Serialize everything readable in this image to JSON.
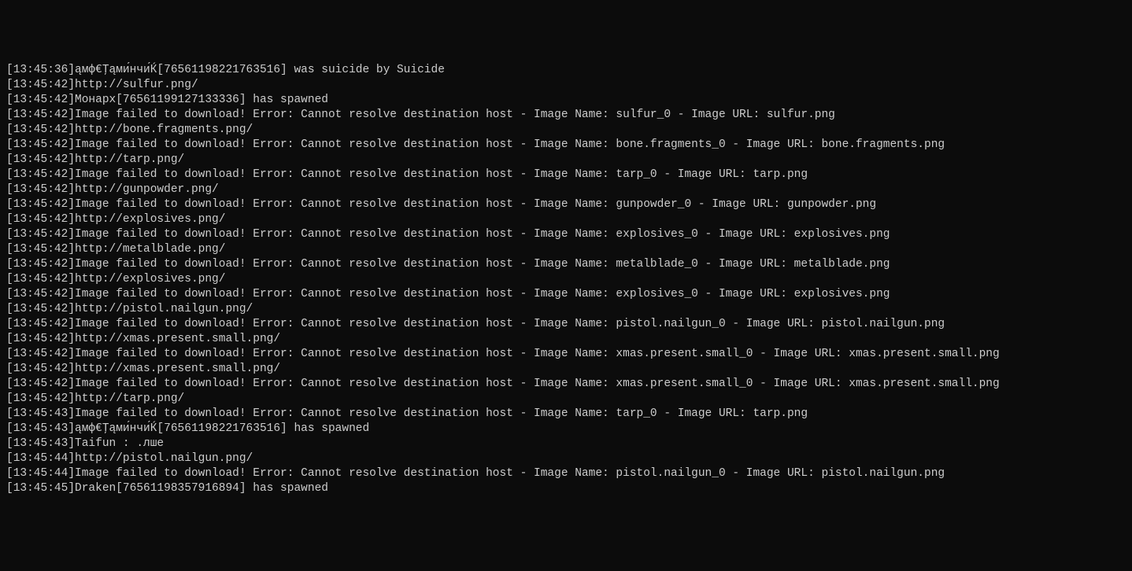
{
  "logs": [
    {
      "time": "[13:45:36]",
      "msg": "ąмф€Ţąми́нчи́Ќ[76561198221763516] was suicide by Suicide"
    },
    {
      "time": "[13:45:42]",
      "msg": "http://sulfur.png/"
    },
    {
      "time": "[13:45:42]",
      "msg": "Монарх[76561199127133336] has spawned"
    },
    {
      "time": "[13:45:42]",
      "msg": "Image failed to download! Error: Cannot resolve destination host - Image Name: sulfur_0 - Image URL: sulfur.png"
    },
    {
      "time": "[13:45:42]",
      "msg": "http://bone.fragments.png/"
    },
    {
      "time": "[13:45:42]",
      "msg": "Image failed to download! Error: Cannot resolve destination host - Image Name: bone.fragments_0 - Image URL: bone.fragments.png"
    },
    {
      "time": "[13:45:42]",
      "msg": "http://tarp.png/"
    },
    {
      "time": "[13:45:42]",
      "msg": "Image failed to download! Error: Cannot resolve destination host - Image Name: tarp_0 - Image URL: tarp.png"
    },
    {
      "time": "[13:45:42]",
      "msg": "http://gunpowder.png/"
    },
    {
      "time": "[13:45:42]",
      "msg": "Image failed to download! Error: Cannot resolve destination host - Image Name: gunpowder_0 - Image URL: gunpowder.png"
    },
    {
      "time": "[13:45:42]",
      "msg": "http://explosives.png/"
    },
    {
      "time": "[13:45:42]",
      "msg": "Image failed to download! Error: Cannot resolve destination host - Image Name: explosives_0 - Image URL: explosives.png"
    },
    {
      "time": "[13:45:42]",
      "msg": "http://metalblade.png/"
    },
    {
      "time": "[13:45:42]",
      "msg": "Image failed to download! Error: Cannot resolve destination host - Image Name: metalblade_0 - Image URL: metalblade.png"
    },
    {
      "time": "[13:45:42]",
      "msg": "http://explosives.png/"
    },
    {
      "time": "[13:45:42]",
      "msg": "Image failed to download! Error: Cannot resolve destination host - Image Name: explosives_0 - Image URL: explosives.png"
    },
    {
      "time": "[13:45:42]",
      "msg": "http://pistol.nailgun.png/"
    },
    {
      "time": "[13:45:42]",
      "msg": "Image failed to download! Error: Cannot resolve destination host - Image Name: pistol.nailgun_0 - Image URL: pistol.nailgun.png"
    },
    {
      "time": "[13:45:42]",
      "msg": "http://xmas.present.small.png/"
    },
    {
      "time": "[13:45:42]",
      "msg": "Image failed to download! Error: Cannot resolve destination host - Image Name: xmas.present.small_0 - Image URL: xmas.present.small.png"
    },
    {
      "time": "[13:45:42]",
      "msg": "http://xmas.present.small.png/"
    },
    {
      "time": "[13:45:42]",
      "msg": "Image failed to download! Error: Cannot resolve destination host - Image Name: xmas.present.small_0 - Image URL: xmas.present.small.png"
    },
    {
      "time": "[13:45:42]",
      "msg": "http://tarp.png/"
    },
    {
      "time": "[13:45:43]",
      "msg": "Image failed to download! Error: Cannot resolve destination host - Image Name: tarp_0 - Image URL: tarp.png"
    },
    {
      "time": "[13:45:43]",
      "msg": "ąмф€Ţąми́нчи́Ќ[76561198221763516] has spawned"
    },
    {
      "time": "[13:45:43]",
      "msg": "Taifun : .лше"
    },
    {
      "time": "[13:45:44]",
      "msg": "http://pistol.nailgun.png/"
    },
    {
      "time": "[13:45:44]",
      "msg": "Image failed to download! Error: Cannot resolve destination host - Image Name: pistol.nailgun_0 - Image URL: pistol.nailgun.png"
    },
    {
      "time": "[13:45:45]",
      "msg": "Draken[76561198357916894] has spawned"
    }
  ]
}
